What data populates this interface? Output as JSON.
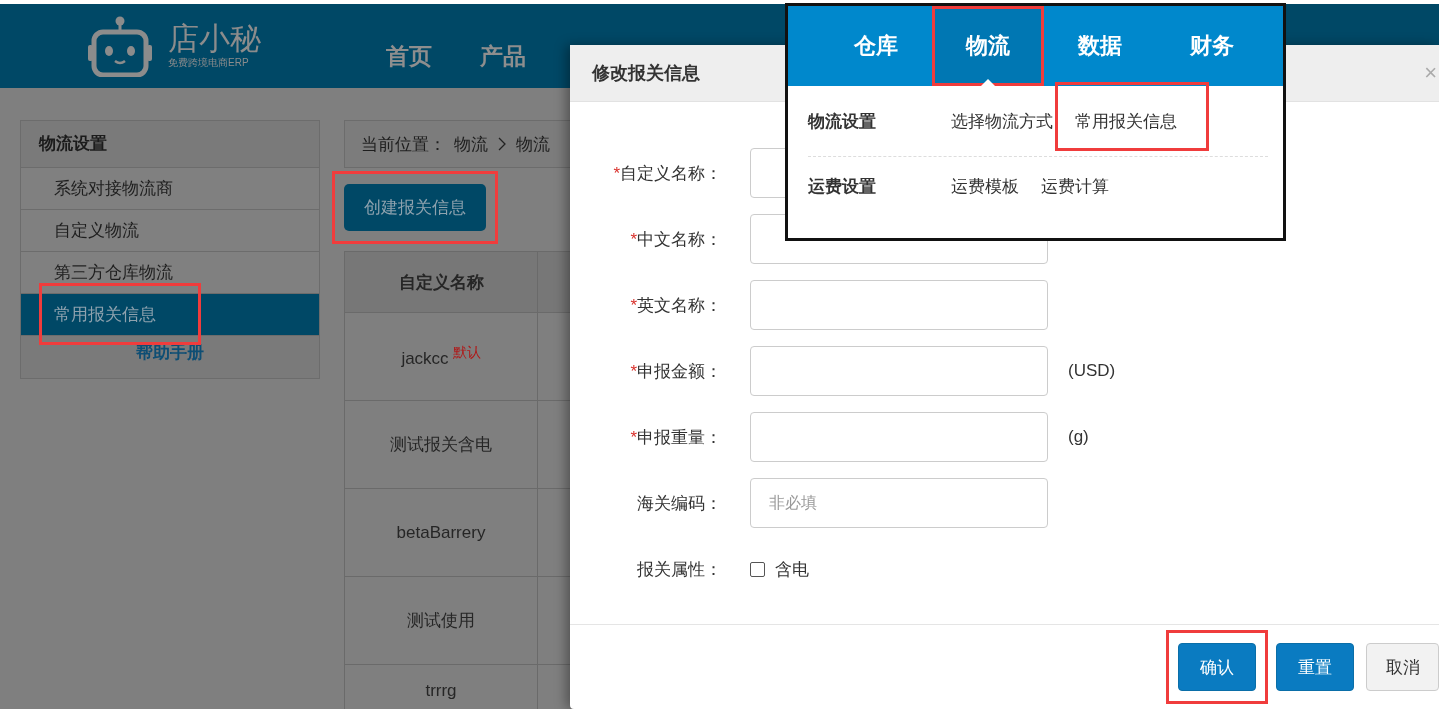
{
  "header": {
    "logo": {
      "name": "店小秘",
      "tagline": "免费跨境电商ERP"
    },
    "nav": [
      {
        "label": "首页"
      },
      {
        "label": "产品"
      }
    ]
  },
  "sidebar": {
    "title": "物流设置",
    "items": [
      {
        "label": "系统对接物流商",
        "selected": false,
        "highlighted": false
      },
      {
        "label": "自定义物流",
        "selected": false,
        "highlighted": false
      },
      {
        "label": "第三方仓库物流",
        "selected": false,
        "highlighted": false
      },
      {
        "label": "常用报关信息",
        "selected": true,
        "highlighted": true
      }
    ],
    "help_link": "帮助手册"
  },
  "breadcrumb": {
    "prefix": "当前位置：",
    "path": [
      "物流",
      "物流"
    ]
  },
  "create_button": {
    "label": "创建报关信息",
    "highlighted": true
  },
  "table": {
    "columns": [
      "自定义名称"
    ],
    "rows": [
      {
        "name": "jackcc",
        "badge": "默认"
      },
      {
        "name": "测试报关含电"
      },
      {
        "name": "betaBarrery"
      },
      {
        "name": "测试使用"
      },
      {
        "name": "trrrg"
      }
    ]
  },
  "dialog": {
    "title": "修改报关信息",
    "close": "×",
    "fields": [
      {
        "kind": "input",
        "mark": "*",
        "label": "自定义名称："
      },
      {
        "kind": "input",
        "mark": "*",
        "label": "中文名称："
      },
      {
        "kind": "input",
        "mark": "*",
        "label": "英文名称："
      },
      {
        "kind": "input",
        "mark": "*",
        "label": "申报金额：",
        "unit": "(USD)"
      },
      {
        "kind": "input",
        "mark": "*",
        "label": "申报重量：",
        "unit": "(g)"
      },
      {
        "kind": "input",
        "label": "海关编码：",
        "placeholder": "非必填"
      },
      {
        "kind": "checkbox",
        "label": "报关属性：",
        "option": "含电",
        "checked": false
      }
    ],
    "buttons": [
      {
        "label": "确认",
        "kind": "primary",
        "highlighted": true
      },
      {
        "label": "重置",
        "kind": "primary",
        "highlighted": false
      },
      {
        "label": "取消",
        "kind": "default",
        "highlighted": false
      }
    ]
  },
  "menu_inset": {
    "tabs": [
      {
        "label": "仓库",
        "selected": false
      },
      {
        "label": "物流",
        "selected": true
      },
      {
        "label": "数据",
        "selected": false
      },
      {
        "label": "财务",
        "selected": false
      }
    ],
    "groups": [
      {
        "title": "物流设置",
        "links": [
          {
            "label": "选择物流方式",
            "highlighted": false
          },
          {
            "label": "常用报关信息",
            "highlighted": true
          }
        ]
      },
      {
        "title": "运费设置",
        "links": [
          {
            "label": "运费模板",
            "highlighted": false
          },
          {
            "label": "运费计算",
            "highlighted": false
          }
        ]
      }
    ]
  }
}
